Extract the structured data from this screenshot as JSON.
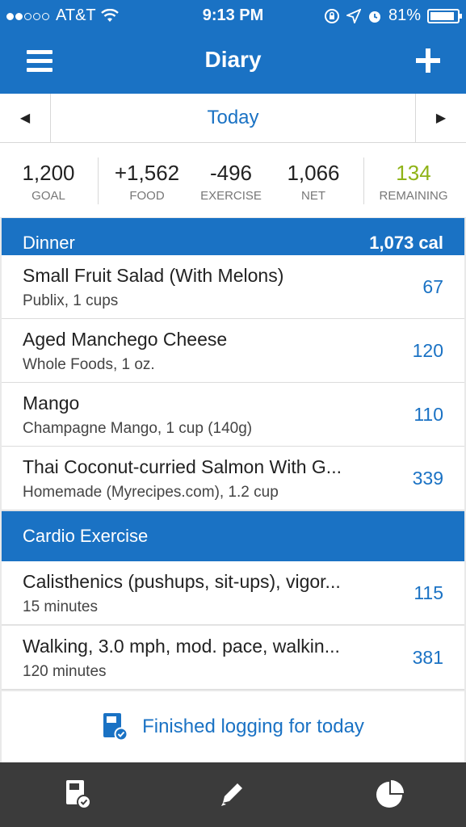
{
  "status_bar": {
    "carrier": "AT&T",
    "time": "9:13 PM",
    "battery": "81%",
    "icons": [
      "signal-dots-icon",
      "wifi-icon",
      "rotation-lock-icon",
      "location-icon",
      "alarm-icon",
      "battery-icon"
    ]
  },
  "nav": {
    "title": "Diary",
    "menu_icon": "hamburger-menu-icon",
    "add_icon": "plus-icon"
  },
  "date": {
    "label": "Today",
    "prev_icon": "triangle-left-icon",
    "next_icon": "triangle-right-icon"
  },
  "summary": {
    "goal": {
      "value": "1,200",
      "label": "GOAL"
    },
    "food": {
      "value": "+1,562",
      "label": "FOOD"
    },
    "exercise": {
      "value": "-496",
      "label": "EXERCISE"
    },
    "net": {
      "value": "1,066",
      "label": "NET"
    },
    "remaining": {
      "value": "134",
      "label": "REMAINING"
    }
  },
  "dinner": {
    "name": "Dinner",
    "calories": "1,073 cal",
    "items": [
      {
        "name": "Small Fruit Salad (With Melons)",
        "detail": "Publix, 1 cups",
        "cal": "67"
      },
      {
        "name": "Aged Manchego Cheese",
        "detail": "Whole Foods, 1 oz.",
        "cal": "120"
      },
      {
        "name": "Mango",
        "detail": "Champagne Mango, 1 cup (140g)",
        "cal": "110"
      },
      {
        "name": "Thai Coconut-curried Salmon With G...",
        "detail": "Homemade (Myrecipes.com), 1.2 cup",
        "cal": "339"
      }
    ]
  },
  "cardio": {
    "name": "Cardio Exercise",
    "items": [
      {
        "name": "Calisthenics (pushups, sit-ups), vigor...",
        "detail": "15 minutes",
        "cal": "115"
      },
      {
        "name": "Walking, 3.0 mph, mod. pace, walkin...",
        "detail": "120 minutes",
        "cal": "381"
      }
    ]
  },
  "finished": {
    "label": "Finished logging for today",
    "icon": "notebook-check-icon"
  },
  "tabbar": {
    "icons": [
      "diary-tab-icon",
      "pencil-icon",
      "pie-chart-icon"
    ]
  },
  "colors": {
    "brand_blue": "#1a72c4",
    "remaining_green": "#8fb317",
    "tabbar": "#3b3b3b"
  }
}
